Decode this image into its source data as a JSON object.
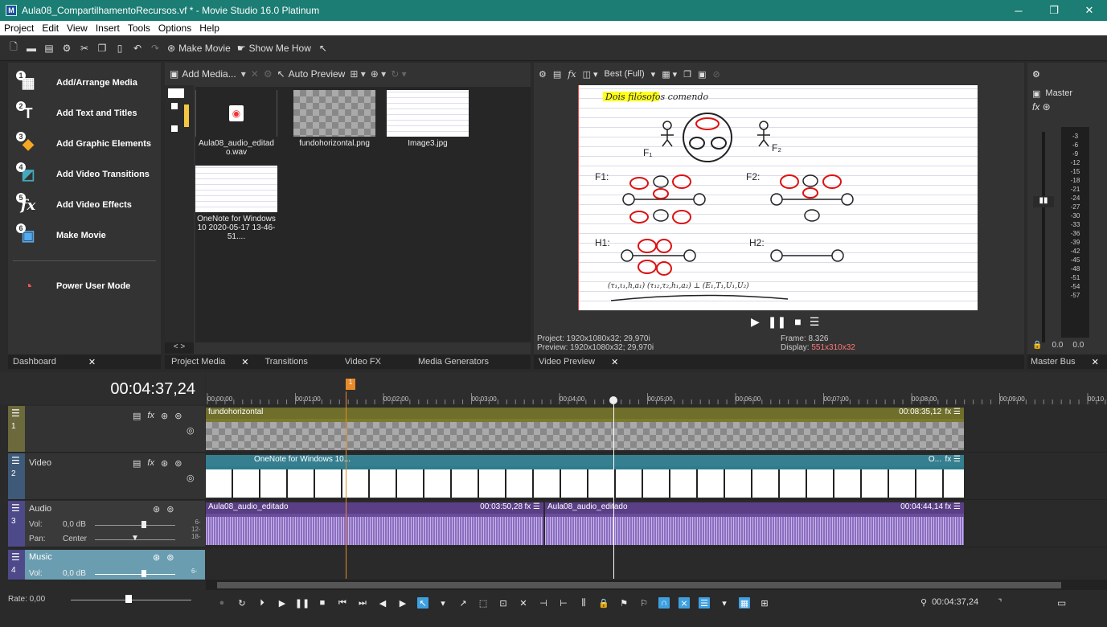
{
  "window": {
    "title": "Aula08_CompartilhamentoRecursos.vf * - Movie Studio 16.0 Platinum",
    "app_badge": "M",
    "minimize": "─",
    "restore": "❐",
    "close": "✕"
  },
  "menu": [
    "Project",
    "Edit",
    "View",
    "Insert",
    "Tools",
    "Options",
    "Help"
  ],
  "toolbar": {
    "make_movie": "Make Movie",
    "show_me_how": "Show Me How"
  },
  "dashboard": {
    "items": [
      {
        "num": "1",
        "label": "Add/Arrange Media",
        "icon": "film-add-icon",
        "glyph": "▦"
      },
      {
        "num": "2",
        "label": "Add Text and Titles",
        "icon": "text-t-icon",
        "glyph": "T"
      },
      {
        "num": "3",
        "label": "Add Graphic Elements",
        "icon": "shapes-icon",
        "glyph": "◆"
      },
      {
        "num": "4",
        "label": "Add Video Transitions",
        "icon": "transition-icon",
        "glyph": "◩"
      },
      {
        "num": "5",
        "label": "Add Video Effects",
        "icon": "fx-icon",
        "glyph": "fx"
      },
      {
        "num": "6",
        "label": "Make Movie",
        "icon": "make-movie-icon",
        "glyph": "▣"
      }
    ],
    "power_user": "Power User Mode",
    "tab": "Dashboard",
    "tab_close": "✕"
  },
  "project_media": {
    "add_media": "Add Media...",
    "auto_preview": "Auto Preview",
    "files": [
      {
        "name": "Aula08_audio_editado.wav",
        "kind": "audio"
      },
      {
        "name": "fundohorizontal.png",
        "kind": "checker"
      },
      {
        "name": "Image3.jpg",
        "kind": "notes"
      },
      {
        "name": "OneNote for Windows 10 2020-05-17 13-46-51....",
        "kind": "notes"
      }
    ],
    "tree_scroll": "< >",
    "tabs": [
      "Project Media",
      "✕",
      "Transitions",
      "Video FX",
      "Media Generators"
    ]
  },
  "preview": {
    "quality": "Best (Full)",
    "project_info": "Project:  1920x1080x32; 29,970i",
    "preview_info": "Preview: 1920x1080x32; 29,970i",
    "frame_label": "Frame:",
    "frame": "8.326",
    "display_label": "Display:",
    "display": "551x310x32",
    "tab": "Video Preview",
    "tab_close": "✕",
    "board": {
      "title": "Dois filósofos comendo",
      "f1": "F₁",
      "f2": "F₂",
      "f1_graph": "F1:",
      "f2_graph": "F2:",
      "h1": "H1:",
      "h2": "H2:",
      "formula": "(τ₁,ι₁,h,a₁) (τ₁₂,τ₂,h₁,a₂) ⊥ (E₁,T₁,U₁,U₂)"
    }
  },
  "master_bus": {
    "title": "Master",
    "fx": "fx",
    "scale": [
      "-3",
      "-6",
      "-9",
      "-12",
      "-15",
      "-18",
      "-21",
      "-24",
      "-27",
      "-30",
      "-33",
      "-36",
      "-39",
      "-42",
      "-45",
      "-48",
      "-51",
      "-54",
      "-57"
    ],
    "left": "0.0",
    "right": "0.0",
    "tab": "Master Bus",
    "tab_close": "✕"
  },
  "timeline": {
    "time": "00:04:37,24",
    "marker": "1",
    "ruler": [
      "00:00:00",
      "00:01:00",
      "00:02:00",
      "00:03:00",
      "00:04:00",
      "00:05:00",
      "00:06:00",
      "00:07:00",
      "00:08:00",
      "00:09:00",
      "00:10"
    ],
    "tracks": [
      {
        "num": "1",
        "name": "",
        "clip": "fundohorizontal",
        "end": "00:08:35,12"
      },
      {
        "num": "2",
        "name": "Video",
        "clip": "OneNote for Windows 10...",
        "tail": "O..."
      },
      {
        "num": "3",
        "name": "Audio",
        "vol_label": "Vol:",
        "vol": "0,0 dB",
        "pan_label": "Pan:",
        "pan": "Center",
        "clip1": "Aula08_audio_editado",
        "clip1_end": "00:03:50,28",
        "clip2": "Aula08_audio_editado",
        "clip2_end": "00:04:44,14",
        "db": [
          "6-",
          "12-",
          "18-"
        ]
      },
      {
        "num": "4",
        "name": "Music",
        "vol_label": "Vol:",
        "vol": "0,0 dB",
        "db": [
          "6-"
        ]
      }
    ],
    "rate_label": "Rate: 0,00",
    "cursor_time": "00:04:37,24"
  }
}
